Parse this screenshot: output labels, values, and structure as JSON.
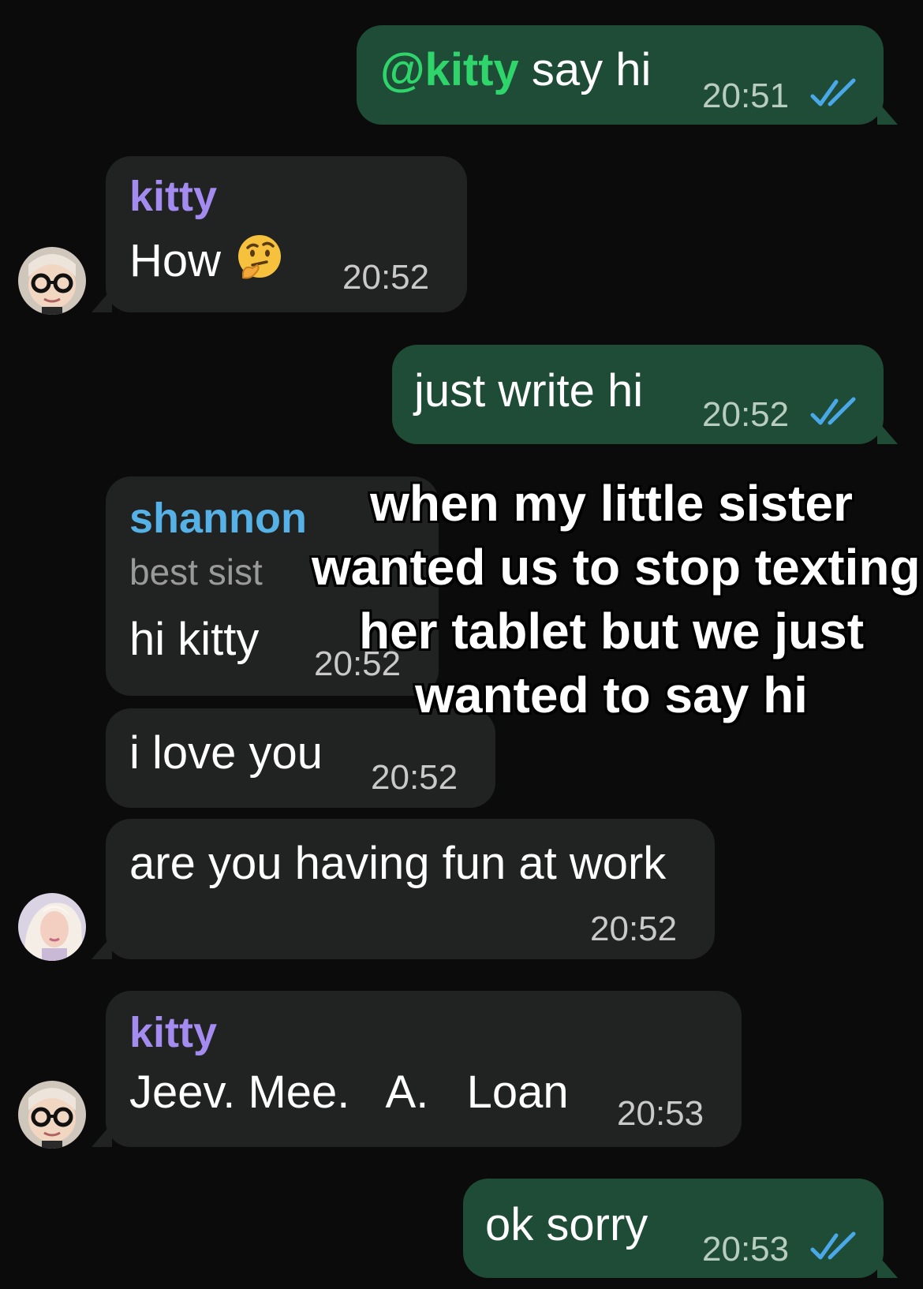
{
  "messages": [
    {
      "direction": "out",
      "mention": "@kitty",
      "text": " say hi",
      "time": "20:51",
      "status": "read"
    },
    {
      "direction": "in",
      "sender": "kitty",
      "text": "How",
      "emoji": "thinking-face",
      "time": "20:52"
    },
    {
      "direction": "out",
      "text": "just write hi",
      "time": "20:52",
      "status": "read"
    },
    {
      "direction": "in",
      "sender": "shannon",
      "sender_title": "best sist",
      "text": "hi kitty",
      "time": "20:52"
    },
    {
      "direction": "in",
      "text": "i love you",
      "time": "20:52"
    },
    {
      "direction": "in",
      "text": "are you having fun at work",
      "time": "20:52"
    },
    {
      "direction": "in",
      "sender": "kitty",
      "text": "Jeev. Mee.   A.   Loan",
      "time": "20:53"
    },
    {
      "direction": "out",
      "text": "ok sorry",
      "time": "20:53",
      "status": "read"
    }
  ],
  "overlay": {
    "lines": [
      "when my little sister",
      "wanted us to stop texting",
      "her tablet but we just",
      "wanted to say hi"
    ]
  },
  "colors": {
    "background": "#0b0b0b",
    "outgoing_bubble": "#1e4c37",
    "incoming_bubble": "#212222",
    "mention": "#2fd46a",
    "sender_kitty": "#a38bf0",
    "sender_shannon": "#56b1e6",
    "read_check": "#4aa8e8"
  }
}
